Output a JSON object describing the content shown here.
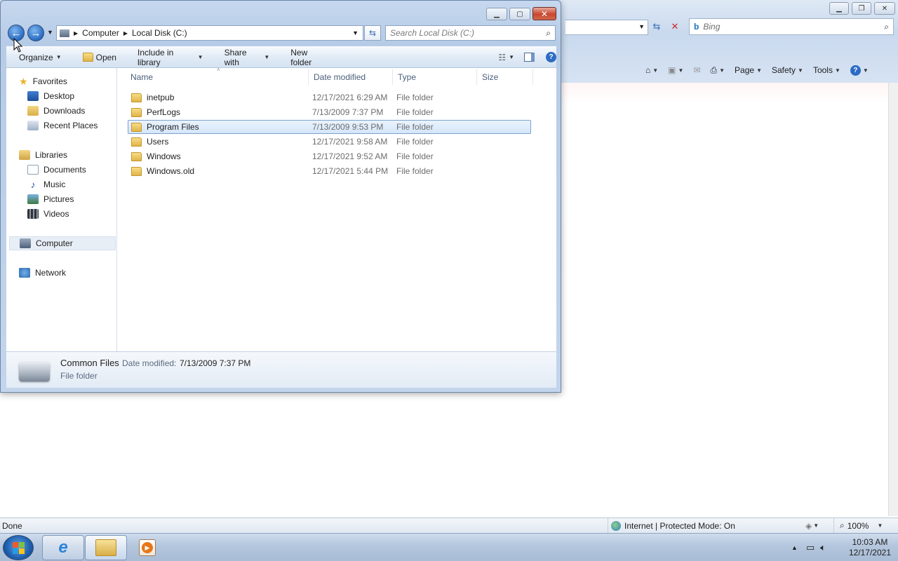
{
  "ie": {
    "search_placeholder": "Bing",
    "command_bar": {
      "page": "Page",
      "safety": "Safety",
      "tools": "Tools"
    },
    "status": {
      "done": "Done",
      "zone": "Internet | Protected Mode: On",
      "zoom": "100%"
    }
  },
  "explorer": {
    "breadcrumb": [
      "Computer",
      "Local Disk (C:)"
    ],
    "search_placeholder": "Search Local Disk (C:)",
    "toolbar": {
      "organize": "Organize",
      "open": "Open",
      "include_in_library": "Include in library",
      "share_with": "Share with",
      "new_folder": "New folder"
    },
    "nav": {
      "favorites": "Favorites",
      "favorites_items": [
        "Desktop",
        "Downloads",
        "Recent Places"
      ],
      "libraries": "Libraries",
      "libraries_items": [
        "Documents",
        "Music",
        "Pictures",
        "Videos"
      ],
      "computer": "Computer",
      "network": "Network"
    },
    "columns": [
      "Name",
      "Date modified",
      "Type",
      "Size"
    ],
    "files": [
      {
        "name": "inetpub",
        "date": "12/17/2021 6:29 AM",
        "type": "File folder"
      },
      {
        "name": "PerfLogs",
        "date": "7/13/2009 7:37 PM",
        "type": "File folder"
      },
      {
        "name": "Program Files",
        "date": "7/13/2009 9:53 PM",
        "type": "File folder",
        "selected": true
      },
      {
        "name": "Users",
        "date": "12/17/2021 9:58 AM",
        "type": "File folder"
      },
      {
        "name": "Windows",
        "date": "12/17/2021 9:52 AM",
        "type": "File folder"
      },
      {
        "name": "Windows.old",
        "date": "12/17/2021 5:44 PM",
        "type": "File folder"
      }
    ],
    "details": {
      "name": "Common Files",
      "date_label": "Date modified:",
      "date_value": "7/13/2009 7:37 PM",
      "type": "File folder"
    }
  },
  "taskbar": {
    "time": "10:03 AM",
    "date": "12/17/2021"
  },
  "colors": {
    "selection_border": "#7da2ce",
    "taskbar": "#b4c6dd",
    "close_button": "#c8462e"
  }
}
